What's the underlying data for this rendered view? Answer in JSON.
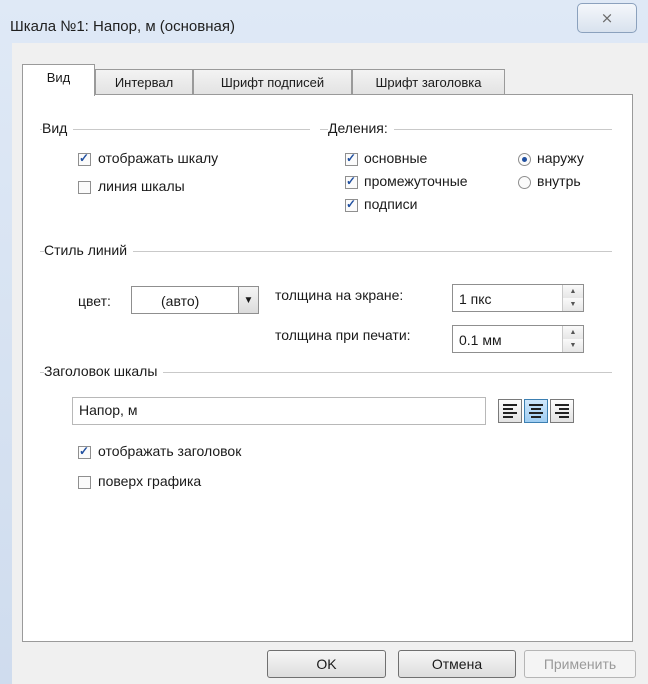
{
  "window": {
    "title": "Шкала №1: Напор, м (основная)",
    "close_glyph": "⨯"
  },
  "tabs": [
    {
      "label": "Вид"
    },
    {
      "label": "Интервал"
    },
    {
      "label": "Шрифт подписей"
    },
    {
      "label": "Шрифт заголовка"
    }
  ],
  "vid_group": {
    "title": "Вид",
    "show_scale": {
      "label": "отображать шкалу",
      "checked": true
    },
    "scale_line": {
      "label": "линия шкалы",
      "checked": false
    }
  },
  "divisions_group": {
    "title": "Деления:",
    "main": {
      "label": "основные",
      "checked": true
    },
    "intermediate": {
      "label": "промежуточные",
      "checked": true
    },
    "captions": {
      "label": "подписи",
      "checked": true
    },
    "outside": {
      "label": "наружу",
      "selected": true
    },
    "inside": {
      "label": "внутрь",
      "selected": false
    }
  },
  "line_style": {
    "title": "Стиль линий",
    "color_label": "цвет:",
    "color_value": "(авто)",
    "thickness_screen_label": "толщина на экране:",
    "thickness_screen_value": "1 пкс",
    "thickness_print_label": "толщина при печати:",
    "thickness_print_value": "0.1 мм"
  },
  "scale_title": {
    "title": "Заголовок шкалы",
    "value": "Напор, м",
    "alignment": "center",
    "show_title": {
      "label": "отображать заголовок",
      "checked": true
    },
    "over_chart": {
      "label": "поверх графика",
      "checked": false
    }
  },
  "buttons": {
    "ok": "OK",
    "cancel": "Отмена",
    "apply": "Применить"
  }
}
